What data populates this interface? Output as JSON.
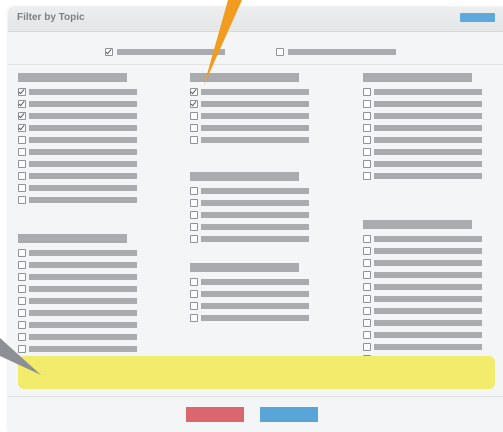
{
  "dialog": {
    "title": "Filter by Topic"
  },
  "toggles": [
    {
      "checked": true
    },
    {
      "checked": false
    }
  ],
  "columns": [
    {
      "groups": [
        {
          "options": [
            true,
            true,
            true,
            true,
            false,
            false,
            false,
            false,
            false,
            false
          ]
        },
        {
          "options": [
            false,
            false,
            false,
            false,
            false,
            false,
            false,
            false,
            false
          ]
        }
      ]
    },
    {
      "groups": [
        {
          "options": [
            true,
            true,
            false,
            false,
            false
          ]
        },
        {
          "options": [
            false,
            false,
            false,
            false,
            false
          ]
        },
        {
          "options": [
            false,
            false,
            false,
            false
          ]
        }
      ]
    },
    {
      "groups": [
        {
          "options": [
            false,
            false,
            false,
            false,
            false,
            false,
            false,
            false
          ]
        },
        {
          "options": [
            false,
            false,
            false,
            false,
            false,
            false,
            false,
            false,
            false,
            false,
            false
          ]
        }
      ]
    }
  ],
  "colors": {
    "yellow_note": "#f1ec6c",
    "cancel_button": "#d9676d",
    "apply_button": "#5aa5d8",
    "callout_orange": "#f29c1f",
    "callout_gray": "#8c8f93"
  }
}
